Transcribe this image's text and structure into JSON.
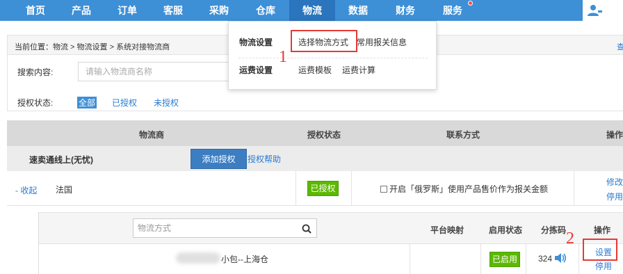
{
  "nav": {
    "items": [
      "首页",
      "产品",
      "订单",
      "客服",
      "采购",
      "仓库",
      "物流",
      "数据",
      "财务",
      "服务"
    ],
    "active": "物流"
  },
  "breadcrumb": {
    "label": "当前位置：",
    "path": "物流 > 物流设置 > 系统对接物流商",
    "right_link": "查"
  },
  "search": {
    "label": "搜索内容:",
    "placeholder": "请输入物流商名称"
  },
  "filter": {
    "label": "授权状态:",
    "options": [
      "全部",
      "已授权",
      "未授权"
    ],
    "active": "全部"
  },
  "dropdown": {
    "groups": [
      {
        "title": "物流设置",
        "links": [
          "选择物流方式",
          "常用报关信息"
        ]
      },
      {
        "title": "运费设置",
        "links": [
          "运费模板",
          "运费计算"
        ]
      }
    ]
  },
  "annotations": [
    "1",
    "2"
  ],
  "table": {
    "headers": [
      "物流商",
      "授权状态",
      "联系方式",
      "操作"
    ]
  },
  "provider": {
    "name": "速卖通线上(无忧)",
    "add_button": "添加授权",
    "help_link": "授权帮助"
  },
  "country_row": {
    "collapse": "- 收起",
    "country": "法国",
    "status": "已授权",
    "checkbox_label": "开启「俄罗斯」使用产品售价作为报关金额",
    "ops": [
      "修改",
      "停用"
    ]
  },
  "sub_table": {
    "search_placeholder": "物流方式",
    "headers": [
      "平台映射",
      "启用状态",
      "分拣码",
      "操作"
    ],
    "row": {
      "method": "小包--上海仓",
      "status": "已启用",
      "code": "324",
      "ops": [
        "设置",
        "停用"
      ]
    }
  },
  "colors": {
    "nav_bg": "#3d8fd6",
    "nav_active": "#2a75bd",
    "link": "#2a7bd0",
    "enabled_green": "#5cb800",
    "annotation_red": "#e53935",
    "primary_button": "#3c7ec1"
  },
  "icons": [
    "user-icon",
    "search-icon",
    "speaker-icon"
  ]
}
